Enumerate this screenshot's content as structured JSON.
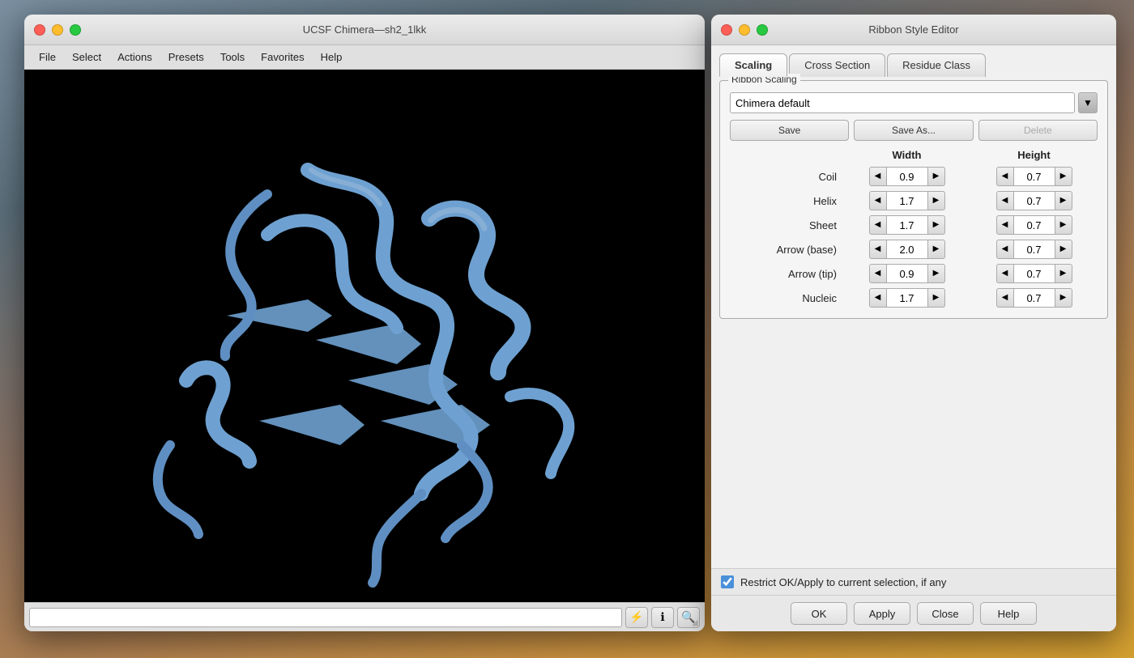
{
  "desktop": {
    "bg_description": "macOS desktop with mountain/nature background"
  },
  "chimera_window": {
    "title": "UCSF Chimera—sh2_1lkk",
    "traffic_lights": {
      "close_label": "close",
      "min_label": "minimize",
      "max_label": "maximize"
    },
    "menu": {
      "items": [
        "File",
        "Select",
        "Actions",
        "Presets",
        "Tools",
        "Favorites",
        "Help"
      ]
    },
    "status_icons": {
      "lightning": "⚡",
      "info": "ℹ",
      "search": "🔍"
    }
  },
  "rse_window": {
    "title": "Ribbon Style Editor",
    "tabs": [
      {
        "id": "scaling",
        "label": "Scaling",
        "active": true
      },
      {
        "id": "cross-section",
        "label": "Cross Section",
        "active": false
      },
      {
        "id": "residue-class",
        "label": "Residue Class",
        "active": false
      }
    ],
    "group_label": "Ribbon Scaling",
    "preset": {
      "value": "Chimera default",
      "dropdown_arrow": "▼"
    },
    "save_buttons": {
      "save": "Save",
      "save_as": "Save As...",
      "delete": "Delete"
    },
    "table": {
      "col_width": "Width",
      "col_height": "Height",
      "rows": [
        {
          "label": "Coil",
          "width": "0.9",
          "height": "0.7"
        },
        {
          "label": "Helix",
          "width": "1.7",
          "height": "0.7"
        },
        {
          "label": "Sheet",
          "width": "1.7",
          "height": "0.7"
        },
        {
          "label": "Arrow (base)",
          "width": "2.0",
          "height": "0.7"
        },
        {
          "label": "Arrow (tip)",
          "width": "0.9",
          "height": "0.7"
        },
        {
          "label": "Nucleic",
          "width": "1.7",
          "height": "0.7"
        }
      ]
    },
    "checkbox": {
      "label": "Restrict OK/Apply to current selection, if any",
      "checked": true
    },
    "bottom_buttons": {
      "ok": "OK",
      "apply": "Apply",
      "close": "Close",
      "help": "Help"
    }
  }
}
